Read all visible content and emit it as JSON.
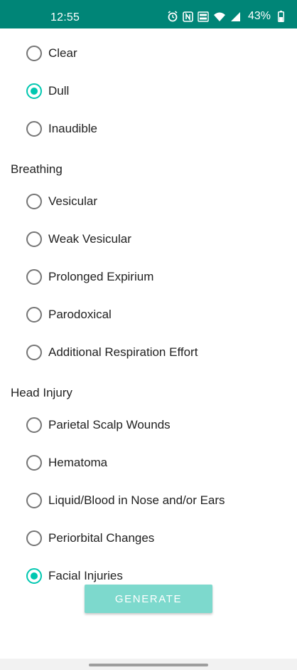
{
  "status_bar": {
    "time": "12:55",
    "battery": "43%",
    "icons": [
      "alarm-icon",
      "nfc-icon",
      "volte-icon",
      "wifi-icon",
      "signal-icon",
      "battery-icon"
    ]
  },
  "top_options": [
    {
      "label": "Clear",
      "checked": false
    },
    {
      "label": "Dull",
      "checked": true
    },
    {
      "label": "Inaudible",
      "checked": false
    }
  ],
  "breathing": {
    "title": "Breathing",
    "options": [
      {
        "label": "Vesicular",
        "checked": false
      },
      {
        "label": "Weak Vesicular",
        "checked": false
      },
      {
        "label": "Prolonged Expirium",
        "checked": false
      },
      {
        "label": "Parodoxical",
        "checked": false
      },
      {
        "label": "Additional Respiration Effort",
        "checked": false
      }
    ]
  },
  "head_injury": {
    "title": "Head Injury",
    "options": [
      {
        "label": "Parietal Scalp Wounds",
        "checked": false
      },
      {
        "label": "Hematoma",
        "checked": false
      },
      {
        "label": "Liquid/Blood in Nose and/or Ears",
        "checked": false
      },
      {
        "label": "Periorbital Changes",
        "checked": false
      },
      {
        "label": "Facial Injuries",
        "checked": true
      }
    ]
  },
  "generate_button": {
    "label": "GENERATE"
  },
  "colors": {
    "status_bar": "#008577",
    "accent": "#00c7b0",
    "button": "#7dd9cd"
  }
}
